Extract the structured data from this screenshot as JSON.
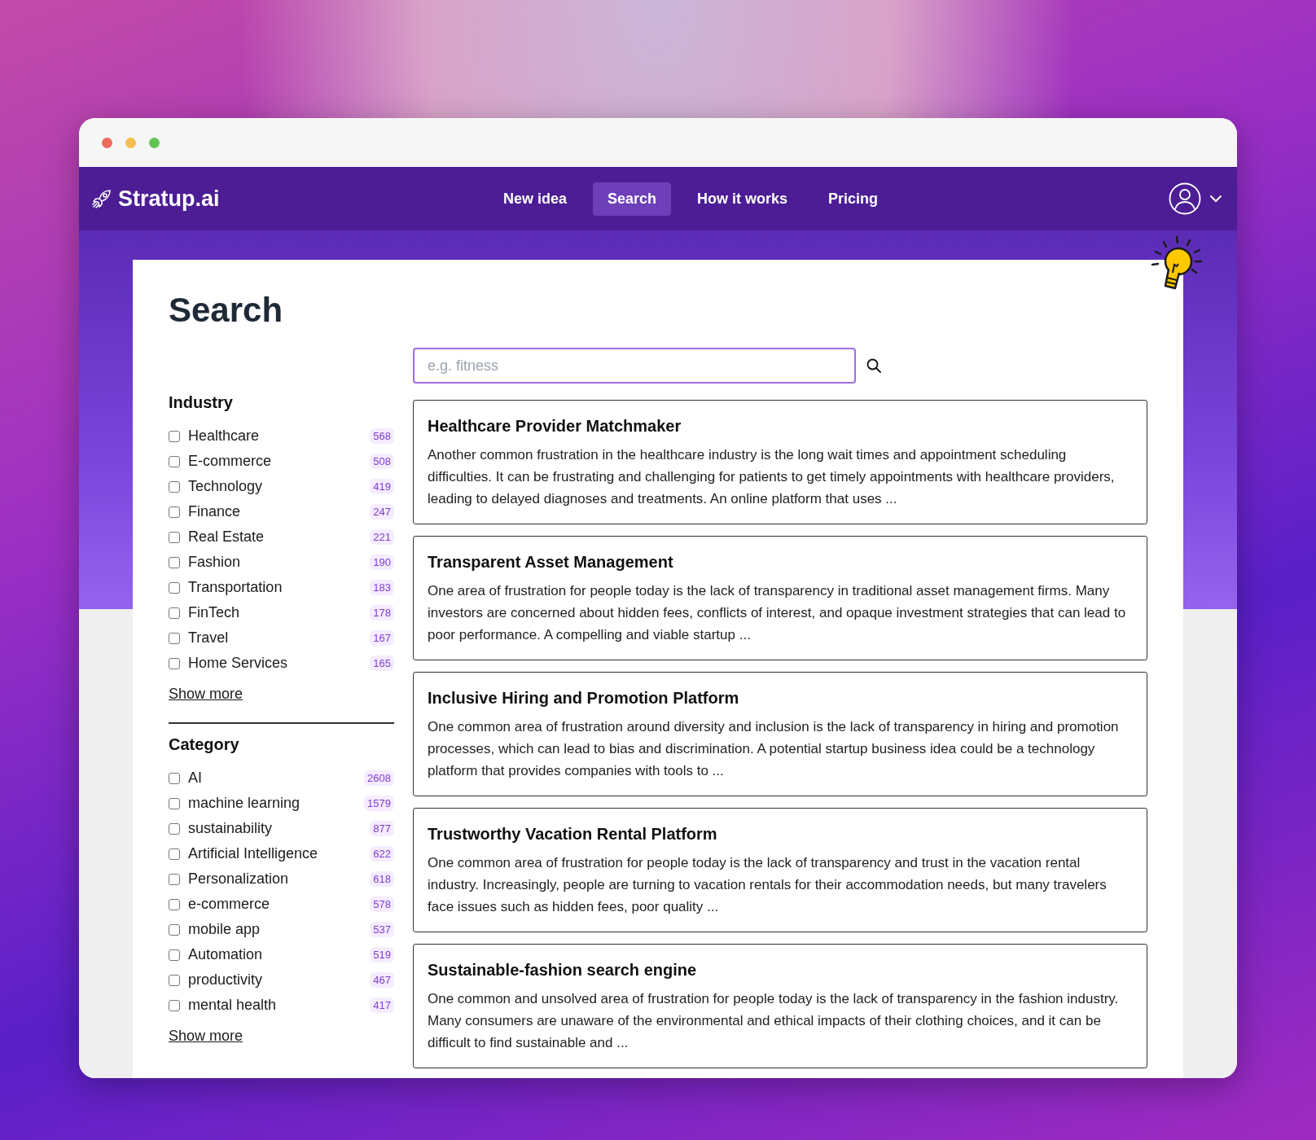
{
  "brand": {
    "name": "Stratup.ai"
  },
  "nav": [
    {
      "label": "New idea",
      "selected": false
    },
    {
      "label": "Search",
      "selected": true
    },
    {
      "label": "How it works",
      "selected": false
    },
    {
      "label": "Pricing",
      "selected": false
    }
  ],
  "page_title": "Search",
  "search": {
    "placeholder": "e.g. fitness"
  },
  "filters": [
    {
      "title": "Industry",
      "show_more": "Show more",
      "items": [
        {
          "label": "Healthcare",
          "count": "568",
          "checked": false
        },
        {
          "label": "E-commerce",
          "count": "508",
          "checked": false
        },
        {
          "label": "Technology",
          "count": "419",
          "checked": false
        },
        {
          "label": "Finance",
          "count": "247",
          "checked": false
        },
        {
          "label": "Real Estate",
          "count": "221",
          "checked": false
        },
        {
          "label": "Fashion",
          "count": "190",
          "checked": false
        },
        {
          "label": "Transportation",
          "count": "183",
          "checked": false
        },
        {
          "label": "FinTech",
          "count": "178",
          "checked": false
        },
        {
          "label": "Travel",
          "count": "167",
          "checked": false
        },
        {
          "label": "Home Services",
          "count": "165",
          "checked": false
        }
      ]
    },
    {
      "title": "Category",
      "show_more": "Show more",
      "items": [
        {
          "label": "AI",
          "count": "2608",
          "checked": false
        },
        {
          "label": "machine learning",
          "count": "1579",
          "checked": false
        },
        {
          "label": "sustainability",
          "count": "877",
          "checked": false
        },
        {
          "label": "Artificial Intelligence",
          "count": "622",
          "checked": false
        },
        {
          "label": "Personalization",
          "count": "618",
          "checked": false
        },
        {
          "label": "e-commerce",
          "count": "578",
          "checked": false
        },
        {
          "label": "mobile app",
          "count": "537",
          "checked": false
        },
        {
          "label": "Automation",
          "count": "519",
          "checked": false
        },
        {
          "label": "productivity",
          "count": "467",
          "checked": false
        },
        {
          "label": "mental health",
          "count": "417",
          "checked": false
        }
      ]
    }
  ],
  "results": [
    {
      "title": "Healthcare Provider Matchmaker",
      "summary": "Another common frustration in the healthcare industry is the long wait times and appointment scheduling difficulties. It can be frustrating and challenging for patients to get timely appointments with healthcare providers, leading to delayed diagnoses and treatments. An online platform that uses ..."
    },
    {
      "title": "Transparent Asset Management",
      "summary": "One area of frustration for people today is the lack of transparency in traditional asset management firms. Many investors are concerned about hidden fees, conflicts of interest, and opaque investment strategies that can lead to poor performance. A compelling and viable startup ..."
    },
    {
      "title": "Inclusive Hiring and Promotion Platform",
      "summary": "One common area of frustration around diversity and inclusion is the lack of transparency in hiring and promotion processes, which can lead to bias and discrimination. A potential startup business idea could be a technology platform that provides companies with tools to ..."
    },
    {
      "title": "Trustworthy Vacation Rental Platform",
      "summary": "One common area of frustration for people today is the lack of transparency and trust in the vacation rental industry. Increasingly, people are turning to vacation rentals for their accommodation needs, but many travelers face issues such as hidden fees, poor quality ..."
    },
    {
      "title": "Sustainable-fashion search engine",
      "summary": "One common and unsolved area of frustration for people today is the lack of transparency in the fashion industry. Many consumers are unaware of the environmental and ethical impacts of their clothing choices, and it can be difficult to find sustainable and ..."
    }
  ]
}
